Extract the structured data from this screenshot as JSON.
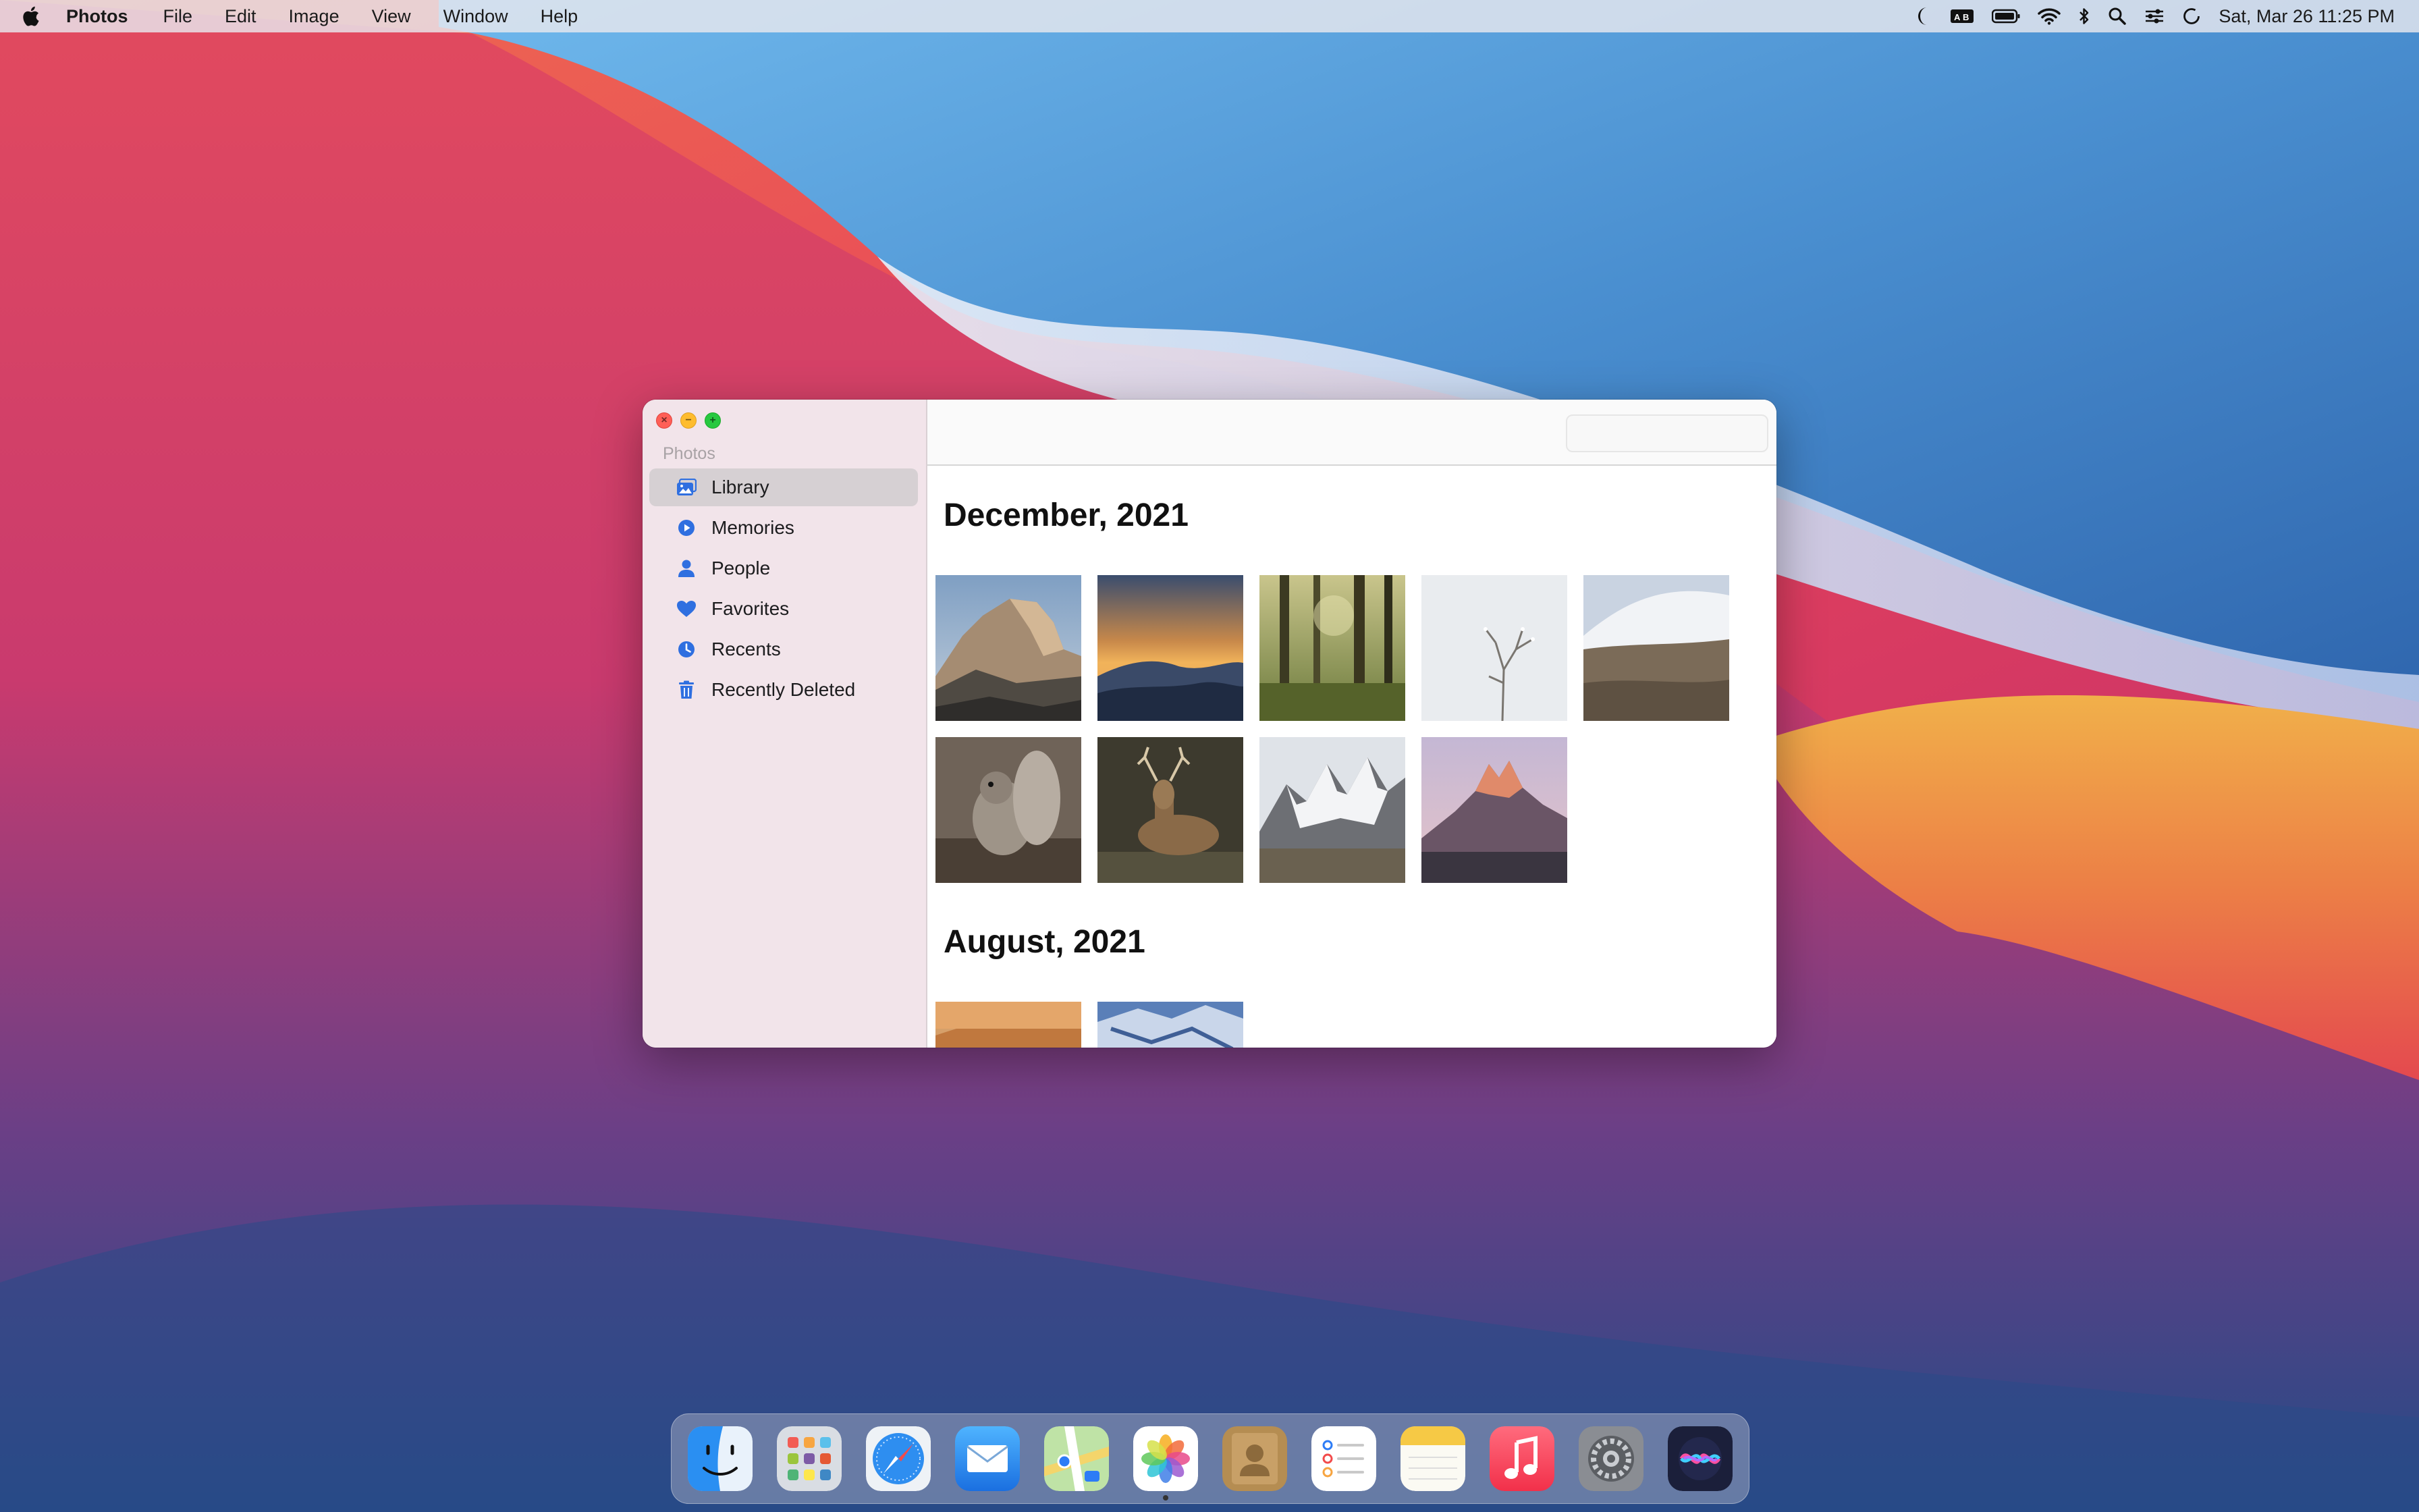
{
  "menubar": {
    "app_name": "Photos",
    "menus": [
      "File",
      "Edit",
      "Image",
      "View",
      "Window",
      "Help"
    ],
    "clock": "Sat, Mar 26  11:25 PM"
  },
  "window": {
    "sidebar": {
      "section_title": "Photos",
      "items": [
        {
          "label": "Library",
          "icon": "library-icon",
          "selected": true
        },
        {
          "label": "Memories",
          "icon": "memories-play-icon",
          "selected": false
        },
        {
          "label": "People",
          "icon": "person-icon",
          "selected": false
        },
        {
          "label": "Favorites",
          "icon": "heart-icon",
          "selected": false
        },
        {
          "label": "Recents",
          "icon": "clock-icon",
          "selected": false
        },
        {
          "label": "Recently Deleted",
          "icon": "trash-icon",
          "selected": false
        }
      ]
    },
    "toolbar": {
      "search_placeholder": ""
    },
    "groups": [
      {
        "title": "December, 2021",
        "photos": [
          "half-dome-mountain",
          "sunset-mountain-ridge",
          "forest-trees",
          "frosted-branch",
          "snowy-hills",
          "squirrel",
          "deer-stag",
          "snowy-peaks",
          "fitz-roy-peaks"
        ]
      },
      {
        "title": "August, 2021",
        "photos": [
          "desert-dune",
          "snowy-mountain-blue-sky"
        ]
      }
    ]
  },
  "dock": {
    "apps": [
      "Finder",
      "Launchpad",
      "Safari",
      "Mail",
      "Maps",
      "Photos",
      "Contacts",
      "Reminders",
      "Notes",
      "Music",
      "System Preferences",
      "Siri"
    ],
    "running": "Photos"
  },
  "colors": {
    "accent": "#2f6fe0",
    "sidebar_bg": "#f2e4ea",
    "selection": "#d6d0d3"
  }
}
